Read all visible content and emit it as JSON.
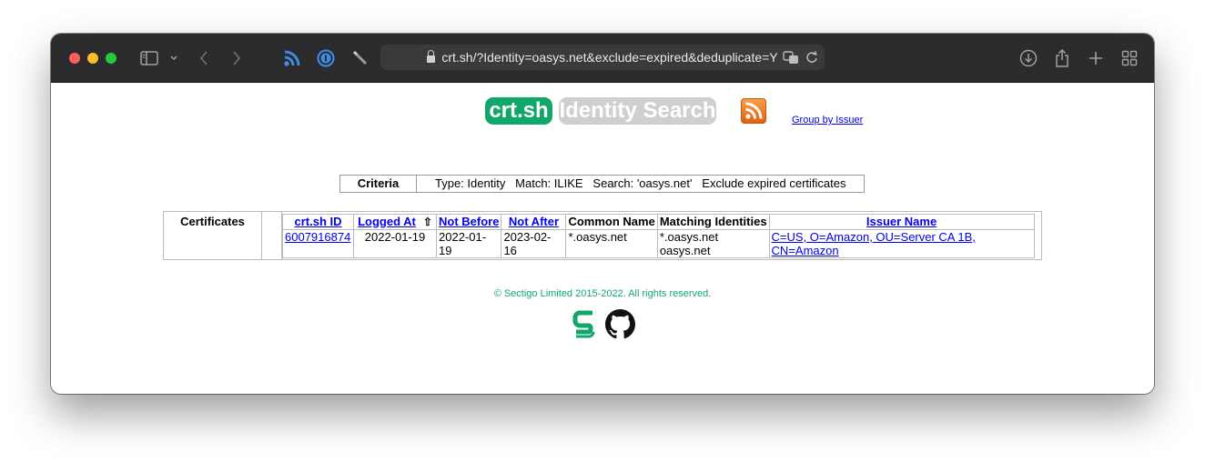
{
  "browser": {
    "url": "crt.sh/?Identity=oasys.net&exclude=expired&deduplicate=Y"
  },
  "header": {
    "logo_primary": "crt.sh",
    "logo_secondary": "Identity Search",
    "group_link": "Group by Issuer"
  },
  "criteria": {
    "label": "Criteria",
    "value": "Type: Identity   Match: ILIKE   Search: 'oasys.net'   Exclude expired certificates"
  },
  "certificates": {
    "label": "Certificates",
    "columns": [
      "crt.sh ID",
      "Logged At",
      "Not Before",
      "Not After",
      "Common Name",
      "Matching Identities",
      "Issuer Name"
    ],
    "sort_indicator": "⇧",
    "rows": [
      {
        "id": "6007916874",
        "logged_at": "2022-01-19",
        "not_before": "2022-01-19",
        "not_after": "2023-02-16",
        "common_name": "*.oasys.net",
        "matching_1": "*.oasys.net",
        "matching_2": "oasys.net",
        "issuer": "C=US, O=Amazon, OU=Server CA 1B, CN=Amazon"
      }
    ]
  },
  "footer": {
    "copyright": "© Sectigo Limited 2015-2022. All rights reserved."
  },
  "colors": {
    "brand_green": "#12a76a",
    "link_blue": "#0000ee",
    "titlebar": "#2c2c2e"
  },
  "icons": [
    "sidebar-icon",
    "chevron-down-icon",
    "back-icon",
    "forward-icon",
    "rss-extension-icon",
    "password-manager-icon",
    "pen-icon",
    "lock-icon",
    "translate-icon",
    "reload-icon",
    "download-icon",
    "share-icon",
    "new-tab-icon",
    "tab-overview-icon",
    "rss-feed-icon",
    "sectigo-icon",
    "github-icon"
  ]
}
